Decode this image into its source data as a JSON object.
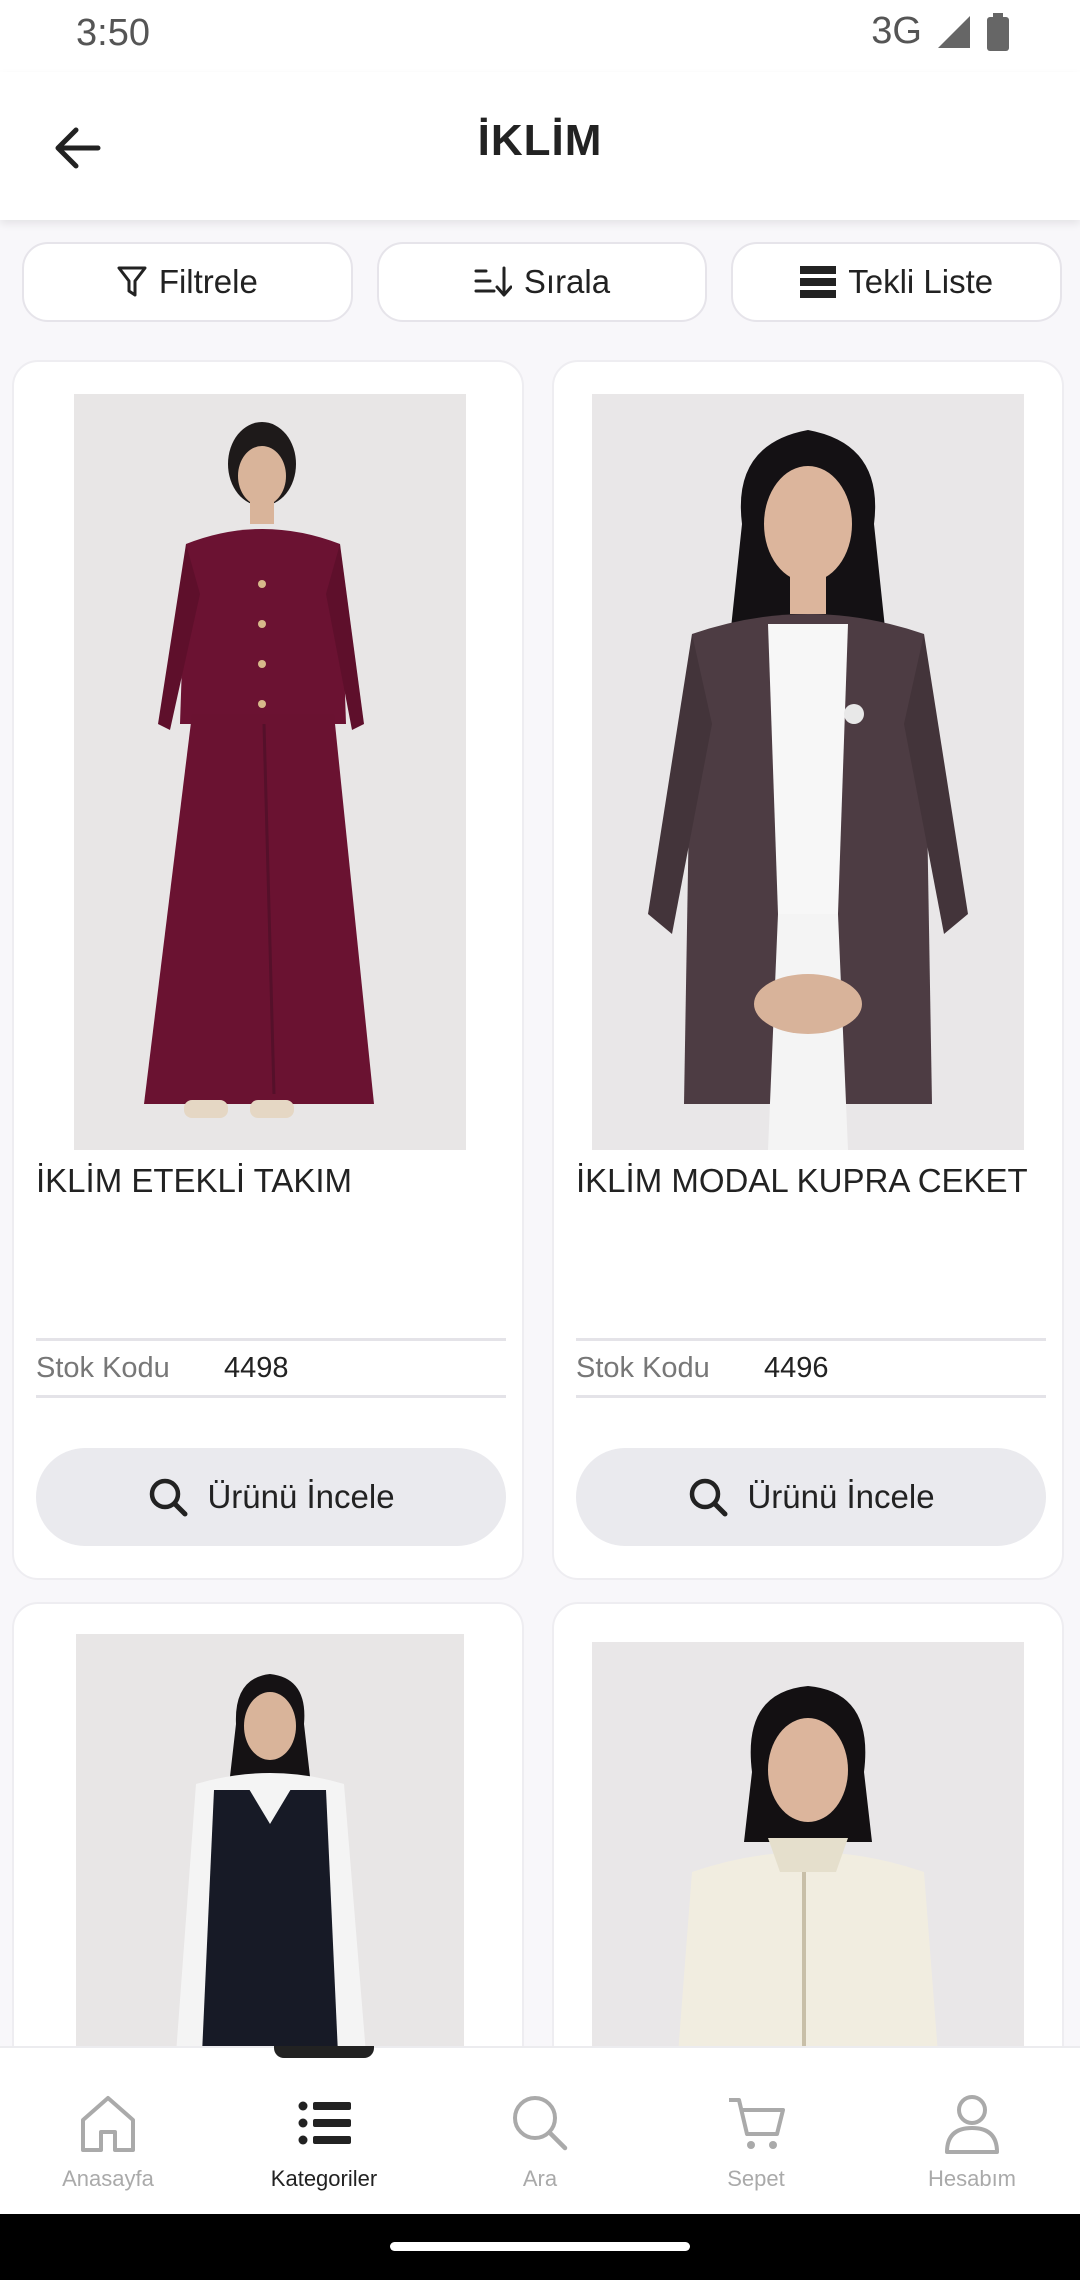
{
  "status": {
    "time": "3:50",
    "network": "3G"
  },
  "header": {
    "title": "İKLİM"
  },
  "toolbar": {
    "filter_label": "Filtrele",
    "sort_label": "Sırala",
    "view_label": "Tekli Liste"
  },
  "products": [
    {
      "name": "İKLİM ETEKLİ TAKIM",
      "stock_label": "Stok Kodu",
      "stock_code": "4498",
      "button_label": "Ürünü İncele"
    },
    {
      "name": "İKLİM MODAL KUPRA CEKET",
      "stock_label": "Stok Kodu",
      "stock_code": "4496",
      "button_label": "Ürünü İncele"
    }
  ],
  "bottom_nav": [
    {
      "label": "Anasayfa",
      "icon": "home-icon"
    },
    {
      "label": "Kategoriler",
      "icon": "list-icon",
      "active": true
    },
    {
      "label": "Ara",
      "icon": "search-icon"
    },
    {
      "label": "Sepet",
      "icon": "cart-icon"
    },
    {
      "label": "Hesabım",
      "icon": "user-icon"
    }
  ],
  "colors": {
    "accent": "#222222",
    "background": "#f8f7fa",
    "button_bg": "#eaeaee"
  }
}
